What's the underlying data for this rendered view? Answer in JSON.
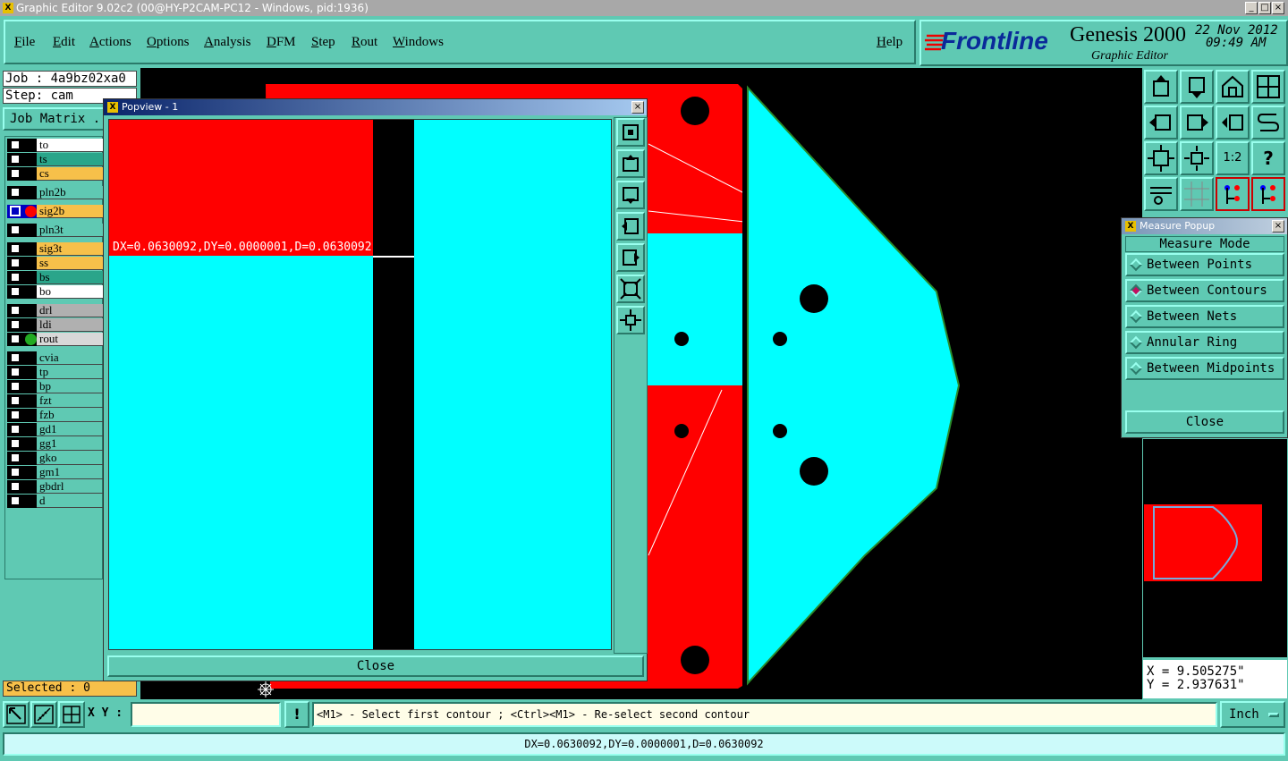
{
  "window": {
    "title": "Graphic Editor 9.02c2 (00@HY-P2CAM-PC12 - Windows, pid:1936)",
    "app_icon": "X"
  },
  "menu": {
    "items": [
      "File",
      "Edit",
      "Actions",
      "Options",
      "Analysis",
      "DFM",
      "Step",
      "Rout",
      "Windows"
    ],
    "help": "Help"
  },
  "brand": {
    "logo": "Frontline",
    "product": "Genesis 2000",
    "subtitle": "Graphic Editor",
    "date": "22 Nov 2012",
    "time": "09:49 AM"
  },
  "job": {
    "job_label": "Job : 4a9bz02xa0",
    "step_label": "Step: cam",
    "matrix_label": "Job Matrix ..",
    "selected": "Selected : 0"
  },
  "layers": [
    {
      "name": "to",
      "color": "#ffffff"
    },
    {
      "name": "ts",
      "color": "#2aa58a"
    },
    {
      "name": "cs",
      "color": "#f7c04a"
    },
    {
      "name": "pln2b",
      "color": "#5fc9b3"
    },
    {
      "name": "sig2b",
      "color": "#f7c04a"
    },
    {
      "name": "pln3t",
      "color": "#5fc9b3"
    },
    {
      "name": "sig3t",
      "color": "#f7c04a"
    },
    {
      "name": "ss",
      "color": "#f7c04a"
    },
    {
      "name": "bs",
      "color": "#2aa58a"
    },
    {
      "name": "bo",
      "color": "#ffffff"
    },
    {
      "name": "drl",
      "color": "#b0b0b0"
    },
    {
      "name": "ldi",
      "color": "#b0b0b0"
    },
    {
      "name": "rout",
      "color": "#d8d8d8"
    },
    {
      "name": "cvia",
      "color": "#5fc9b3"
    },
    {
      "name": "tp",
      "color": "#5fc9b3"
    },
    {
      "name": "bp",
      "color": "#5fc9b3"
    },
    {
      "name": "fzt",
      "color": "#5fc9b3"
    },
    {
      "name": "fzb",
      "color": "#5fc9b3"
    },
    {
      "name": "gd1",
      "color": "#5fc9b3"
    },
    {
      "name": "gg1",
      "color": "#5fc9b3"
    },
    {
      "name": "gko",
      "color": "#5fc9b3"
    },
    {
      "name": "gm1",
      "color": "#5fc9b3"
    },
    {
      "name": "gbdrl",
      "color": "#5fc9b3"
    },
    {
      "name": "d",
      "color": "#5fc9b3"
    }
  ],
  "popview": {
    "title": "Popview - 1",
    "measurement": "DX=0.0630092,DY=0.0000001,D=0.0630092",
    "close": "Close"
  },
  "measure": {
    "title": "Measure Popup",
    "mode_label": "Measure Mode",
    "options": [
      "Between Points",
      "Between Contours",
      "Between Nets",
      "Annular Ring",
      "Between Midpoints"
    ],
    "selected": "Between Contours",
    "close": "Close"
  },
  "coords": {
    "x": "X = 9.505275\"",
    "y": "Y = 2.937631\""
  },
  "toolbar": {
    "xy_label": "X Y :",
    "xy_value": "",
    "bang": "!",
    "prompt": "<M1> - Select first contour ; <Ctrl><M1> - Re-select second contour",
    "units": "Inch",
    "ratio_label": "1:2",
    "help_label": "?"
  },
  "status": {
    "text": "DX=0.0630092,DY=0.0000001,D=0.0630092"
  },
  "colors": {
    "panel": "#5fc9b3",
    "copper_red": "#ff0000",
    "cyan": "#00ffff"
  }
}
